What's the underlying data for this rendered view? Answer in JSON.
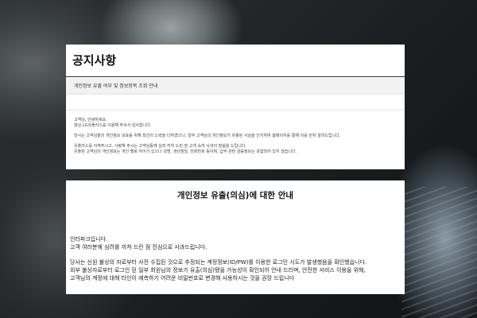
{
  "notice": {
    "title": "공지사항",
    "subject": "개인정보 유출 여부 및 정보항목 조회 안내",
    "greeting_lines": [
      "고객님, 안녕하세요.",
      "항상 LG유플러스를 이용해 주셔서 감사합니다."
    ],
    "paragraph_lines": [
      "당사는 고객님들의 개인정보 보호를 위해 최선의 노력을 다하였으나, 일부 고객님의 개인정보가 유출된 사실을 인지하여 홈페이지를 통해 이를 먼저 알려드립니다.",
      "유플러스를 아껴주시고, 사랑해 주시는 고객님들께 심려 끼쳐 드린 점 고개 숙여 사과의 말씀을 드립니다.",
      "유출된 고객님의 개인정보는 개인 별로 차이가 있으나 성명, 생년월일, 전화번호 등이며, 납부 관련 금융정보는 포함되어 있지 않습니다."
    ]
  },
  "announcement": {
    "title": "개인정보 유출(의심)에 대한 안내",
    "intro_lines": [
      "인터파크입니다.",
      "고객 여러분께 심려를 끼쳐 드린 점 진심으로 사과드립니다."
    ],
    "body_lines": [
      "당사는 신원 불상의 자로부터 사전 수집된 것으로 추정되는 계정정보(ID/PW)를 이용한 로그인 시도가 발생했음을 확인했습니다.",
      "외부 불상자로부터 로그인 된 일부 회원님의 정보가 유출(의심)됐을 가능성이 확인되어 안내 드리며, 안전한 서비스 이용을 위해,",
      "고객님의 계정에 대해 타인이 예측하기 어려운 비밀번호로 변경해 사용하시는 것을 권장 드립니다"
    ]
  },
  "colors": {
    "panel": "#ffffff",
    "subject_bar": "#f2f2f2",
    "title_rule": "#333333",
    "background": "#1d2226"
  }
}
